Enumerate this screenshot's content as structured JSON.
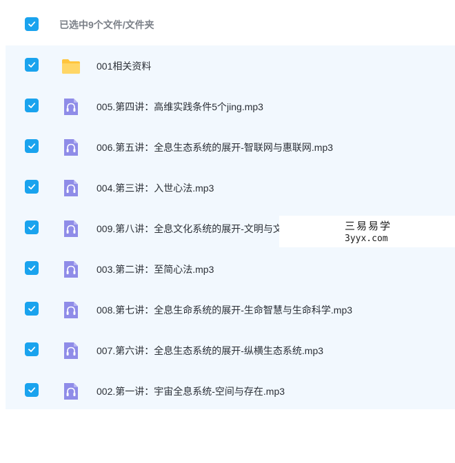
{
  "header": {
    "selection_text": "已选中9个文件/文件夹"
  },
  "colors": {
    "accent": "#1aa3ee",
    "folder": "#ffc53d",
    "audio": "#8f8ce8",
    "row_bg": "#f2f8fe"
  },
  "files": [
    {
      "name": "001相关资料",
      "type": "folder",
      "icon": "folder-icon"
    },
    {
      "name": "005.第四讲：高维实践条件5个jing.mp3",
      "type": "audio",
      "icon": "headphones-icon"
    },
    {
      "name": "006.第五讲：全息生态系统的展开-智联网与惠联网.mp3",
      "type": "audio",
      "icon": "headphones-icon"
    },
    {
      "name": "004.第三讲：入世心法.mp3",
      "type": "audio",
      "icon": "headphones-icon"
    },
    {
      "name": "009.第八讲：全息文化系统的展开-文明与文",
      "type": "audio",
      "icon": "headphones-icon"
    },
    {
      "name": "003.第二讲：至简心法.mp3",
      "type": "audio",
      "icon": "headphones-icon"
    },
    {
      "name": "008.第七讲：全息生命系统的展开-生命智慧与生命科学.mp3",
      "type": "audio",
      "icon": "headphones-icon"
    },
    {
      "name": "007.第六讲：全息生态系统的展开-纵横生态系统.mp3",
      "type": "audio",
      "icon": "headphones-icon"
    },
    {
      "name": "002.第一讲：宇宙全息系统-空间与存在.mp3",
      "type": "audio",
      "icon": "headphones-icon"
    }
  ],
  "watermark": {
    "text": "三易易学",
    "url": "3yyx.com"
  }
}
